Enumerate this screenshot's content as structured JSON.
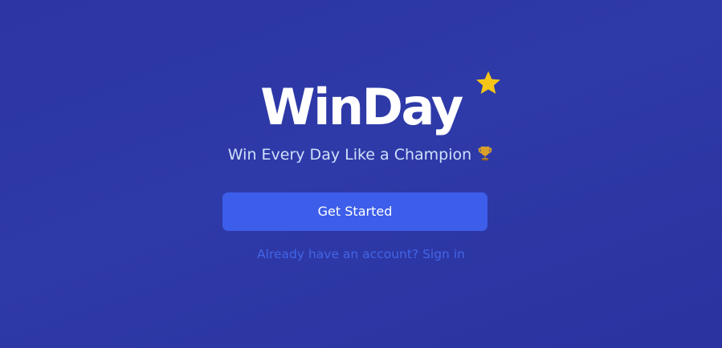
{
  "brand": {
    "name": "WinDay",
    "badge_icon": "star-icon",
    "badge_color": "#f5c518"
  },
  "hero": {
    "tagline": "Win Every Day Like a Champion",
    "tagline_icon": "trophy-icon"
  },
  "actions": {
    "primary_label": "Get Started",
    "signin_text": "Already have an account? Sign in"
  },
  "colors": {
    "background": "#2d37a6",
    "button": "#3d5eea",
    "link": "#4465e6",
    "tagline": "#cfe0fb"
  }
}
